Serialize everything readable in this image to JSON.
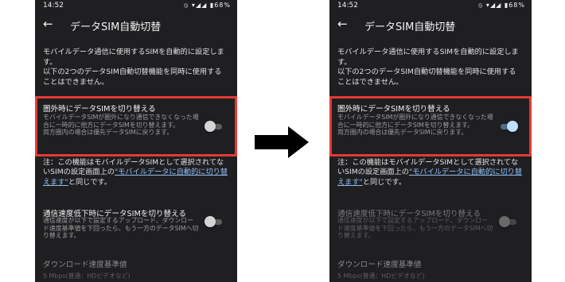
{
  "screens": [
    {
      "id": "before",
      "status_bar": {
        "time": "14:52",
        "icons": "⦸ ▾◢◢",
        "battery": "▮68%"
      },
      "app_bar": {
        "title": "データSIM自動切替"
      },
      "description": "モバイルデータ通信に使用するSIMを自動的に設定します。\n以下の2つのデータSIM自動切替機能を同時に使用することはできません。",
      "out_of_range_switch": {
        "title": "圏外時にデータSIMを切り替える",
        "description": "モバイルデータSIMが圏外になり通信できなくなった場合に一時的に他方にデータSIMを切り替えます。\n両方圏内の場合は優先データSIMに戻ります。",
        "state": "off"
      },
      "note": {
        "prefix": "注：この機能はモバイルデータSIMとして選択されてないSIMの設定画面上の",
        "link": "\"モバイルデータに自動的に切り替えます\"",
        "suffix": "と同じです。"
      },
      "low_speed_switch": {
        "title": "通信速度低下時にデータSIMを切り替える",
        "description": "通信速度が以下で設定するアップロード、ダウンロード速度基準値を下回ったら、もう一方のデータSIMへ切り替えます。",
        "state": "off",
        "enabled": true
      },
      "download_threshold": {
        "title": "ダウンロード速度基準値",
        "value": "5 Mbps(普通：HDビデオなど)"
      }
    },
    {
      "id": "after",
      "status_bar": {
        "time": "14:52",
        "icons": "⦸ ▾◢◢",
        "battery": "▮68%"
      },
      "app_bar": {
        "title": "データSIM自動切替"
      },
      "description": "モバイルデータ通信に使用するSIMを自動的に設定します。\n以下の2つのデータSIM自動切替機能を同時に使用することはできません。",
      "out_of_range_switch": {
        "title": "圏外時にデータSIMを切り替える",
        "description": "モバイルデータSIMが圏外になり通信できなくなった場合に一時的に他方にデータSIMを切り替えます。\n両方圏内の場合は優先データSIMに戻ります。",
        "state": "on"
      },
      "note": {
        "prefix": "注：この機能はモバイルデータSIMとして選択されてないSIMの設定画面上の",
        "link": "\"モバイルデータに自動的に切り替えます\"",
        "suffix": "と同じです。"
      },
      "low_speed_switch": {
        "title": "通信速度低下時にデータSIMを切り替える",
        "description": "通信速度が以下で設定するアップロード、ダウンロード速度基準値を下回ったら、もう一方のデータSIMへ切り替えます。",
        "state": "off",
        "enabled": false
      },
      "download_threshold": {
        "title": "ダウンロード速度基準値",
        "value": "5 Mbps(普通：HDビデオなど)"
      }
    }
  ],
  "colors": {
    "screen_bg": "#1f1f22",
    "highlight_frame": "#e53935",
    "link": "#8fbdf2",
    "switch_on_thumb": "#bfe0ff",
    "arrow": "#000000"
  },
  "arrow": {
    "icon": "right-arrow-icon"
  }
}
